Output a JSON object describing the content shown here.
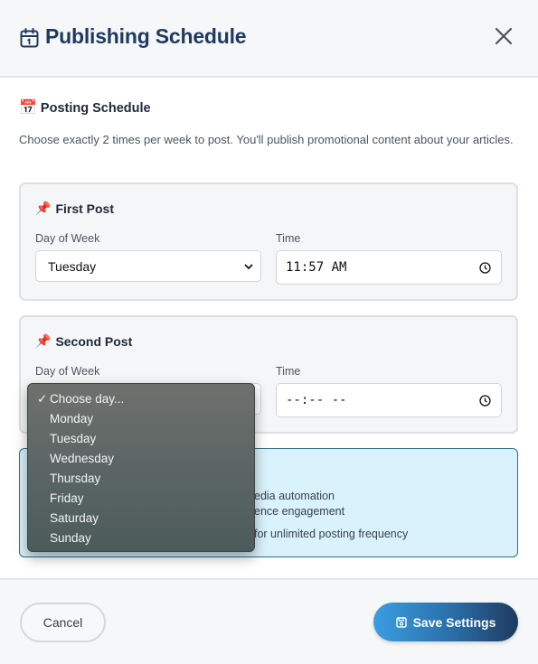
{
  "header": {
    "title": "Publishing Schedule",
    "icon": "calendar-icon",
    "close_icon": "close-icon"
  },
  "section": {
    "title": "Posting Schedule",
    "emoji": "📅",
    "description": "Choose exactly 2 times per week to post. You'll publish promotional content about your articles."
  },
  "posts": [
    {
      "title": "First Post",
      "emoji": "📌",
      "day_label": "Day of Week",
      "day_value": "Tuesday",
      "time_label": "Time",
      "time_value": "11:57 AM"
    },
    {
      "title": "Second Post",
      "emoji": "📌",
      "day_label": "Day of Week",
      "day_value": "Choose day...",
      "time_label": "Time",
      "time_value": "--:-- --"
    }
  ],
  "info": {
    "line1": "edia automation",
    "line2": "ence engagement",
    "line3": "for unlimited posting frequency"
  },
  "dropdown": {
    "checkmark": "✓",
    "options": [
      "Choose day...",
      "Monday",
      "Tuesday",
      "Wednesday",
      "Thursday",
      "Friday",
      "Saturday",
      "Sunday"
    ],
    "selected_index": 0
  },
  "footer": {
    "cancel_label": "Cancel",
    "save_label": "Save Settings",
    "save_icon": "floppy-disk-icon"
  },
  "colors": {
    "title": "#1e3a5f",
    "info_bg": "#d9f2fb",
    "info_border": "#2b6f88",
    "save_gradient_start": "#3a9ee0",
    "save_gradient_end": "#1e3a5f"
  }
}
